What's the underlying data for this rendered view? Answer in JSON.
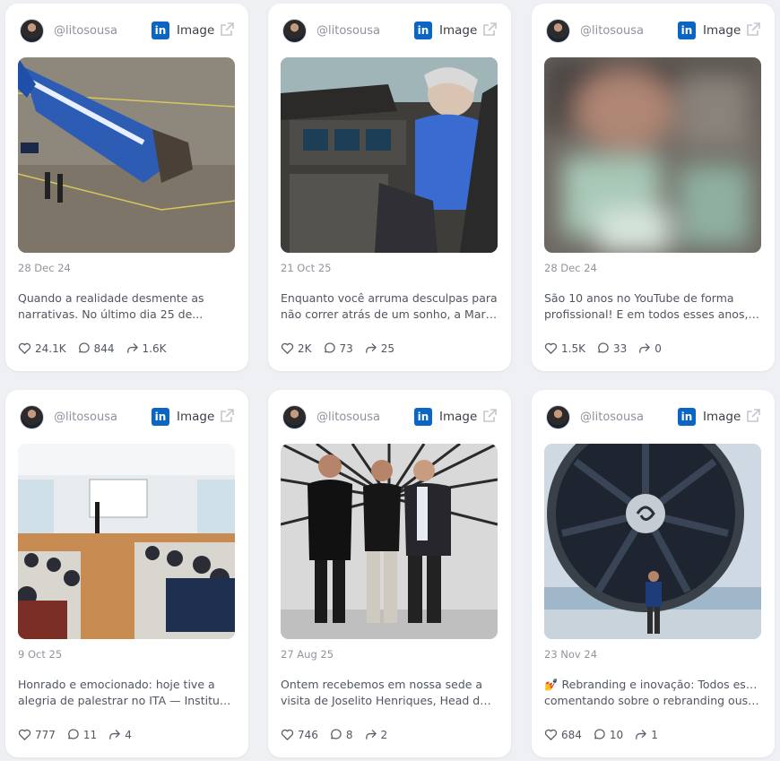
{
  "posts": [
    {
      "handle": "@litosousa",
      "platform": "linkedin-icon",
      "type": "Image",
      "date": "28 Dec 24",
      "text_line1": "Quando a realidade desmente as",
      "text_line2": "narrativas. No último dia 25 de...",
      "likes": "24.1K",
      "comments": "844",
      "shares": "1.6K",
      "image": "plane-crash-photo"
    },
    {
      "handle": "@litosousa",
      "platform": "linkedin-icon",
      "type": "Image",
      "date": "21 Oct 25",
      "text_line1": "Enquanto você arruma desculpas para",
      "text_line2": "não correr atrás de um sonho, a Mari,...",
      "likes": "2K",
      "comments": "73",
      "shares": "25",
      "image": "cockpit-photo"
    },
    {
      "handle": "@litosousa",
      "platform": "linkedin-icon",
      "type": "Image",
      "date": "28 Dec 24",
      "text_line1": "São 10 anos no YouTube de forma",
      "text_line2": "profissional! E em todos esses anos, se...",
      "likes": "1.5K",
      "comments": "33",
      "shares": "0",
      "image": "blurred-photo"
    },
    {
      "handle": "@litosousa",
      "platform": "linkedin-icon",
      "type": "Image",
      "date": "9 Oct 25",
      "text_line1": "Honrado e emocionado: hoje tive a",
      "text_line2": "alegria de palestrar no ITA — Instituto...",
      "likes": "777",
      "comments": "11",
      "shares": "4",
      "image": "lecture-hall-photo"
    },
    {
      "handle": "@litosousa",
      "platform": "linkedin-icon",
      "type": "Image",
      "date": "27 Aug 25",
      "text_line1": "Ontem recebemos em nossa sede a",
      "text_line2": "visita de Joselito Henriques, Head do P&...",
      "likes": "746",
      "comments": "8",
      "shares": "2",
      "image": "three-men-photo"
    },
    {
      "handle": "@litosousa",
      "platform": "linkedin-icon",
      "type": "Image",
      "date": "23 Nov 24",
      "text_line1": "💅 Rebranding e inovação: Todos estão",
      "text_line2": "comentando sobre o rebranding ousad...",
      "likes": "684",
      "comments": "10",
      "shares": "1",
      "image": "jet-engine-photo"
    }
  ],
  "colors": {
    "linkedin": "#0a66c2",
    "background": "#eef0f4",
    "card": "#ffffff",
    "muted": "#8f949d"
  }
}
